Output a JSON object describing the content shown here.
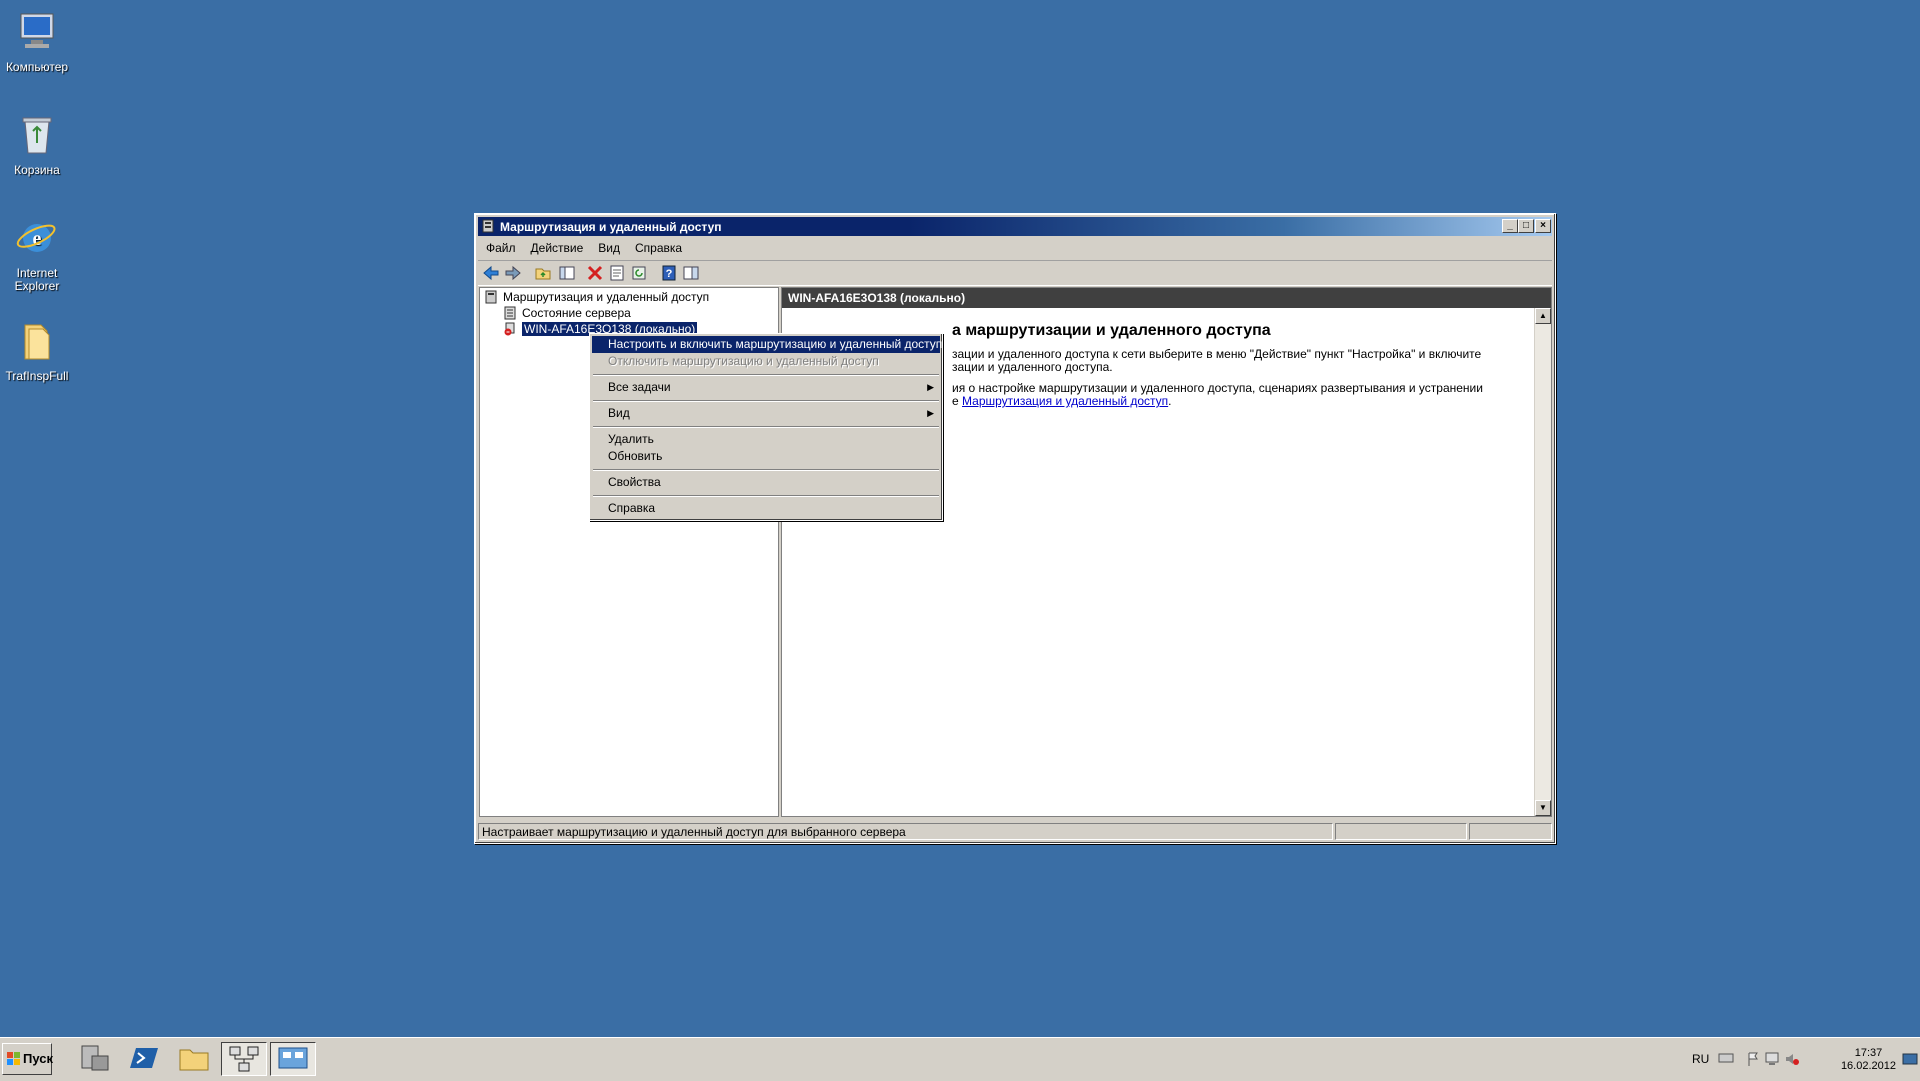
{
  "desktop": {
    "icons": [
      {
        "label": "Компьютер",
        "icon": "computer-icon"
      },
      {
        "label": "Корзина",
        "icon": "recycle-bin-icon"
      },
      {
        "label": "Internet Explorer",
        "icon": "internet-explorer-icon"
      },
      {
        "label": "TrafInspFull",
        "icon": "folder-icon"
      }
    ]
  },
  "window": {
    "title": "Маршрутизация и удаленный доступ",
    "menu": [
      "Файл",
      "Действие",
      "Вид",
      "Справка"
    ],
    "tree": {
      "root": "Маршрутизация и удаленный доступ",
      "server_status": "Состояние сервера",
      "server": "WIN-AFA16E3O138 (локально)"
    },
    "right": {
      "header": "WIN-AFA16E3O138 (локально)",
      "title_visible": "а маршрутизации и удаленного доступа",
      "para1_line1": "зации и удаленного доступа к сети выберите в меню \"Действие\" пункт \"Настройка\" и включите",
      "para1_line2": "зации и удаленного доступа.",
      "para2_line1": "ия о настройке маршрутизации и удаленного доступа, сценариях развертывания и устранении",
      "para2_prefix": "е ",
      "para2_link": "Маршрутизация и удаленный доступ",
      "para2_suffix": "."
    },
    "status": "Настраивает маршрутизацию и удаленный доступ для выбранного сервера"
  },
  "context_menu": {
    "items": [
      {
        "label": "Настроить и включить маршрутизацию и удаленный доступ",
        "state": "highlighted"
      },
      {
        "label": "Отключить маршрутизацию и удаленный доступ",
        "state": "disabled"
      },
      {
        "label": "Все задачи",
        "submenu": true
      },
      {
        "label": "Вид",
        "submenu": true
      },
      {
        "label": "Удалить"
      },
      {
        "label": "Обновить"
      },
      {
        "label": "Свойства"
      },
      {
        "label": "Справка"
      }
    ]
  },
  "taskbar": {
    "start_label": "Пуск",
    "language": "RU",
    "time": "17:37",
    "date": "16.02.2012"
  },
  "colors": {
    "desktop": "#3a6ea5",
    "selection": "#0a246a",
    "chrome": "#d4d0c8"
  }
}
